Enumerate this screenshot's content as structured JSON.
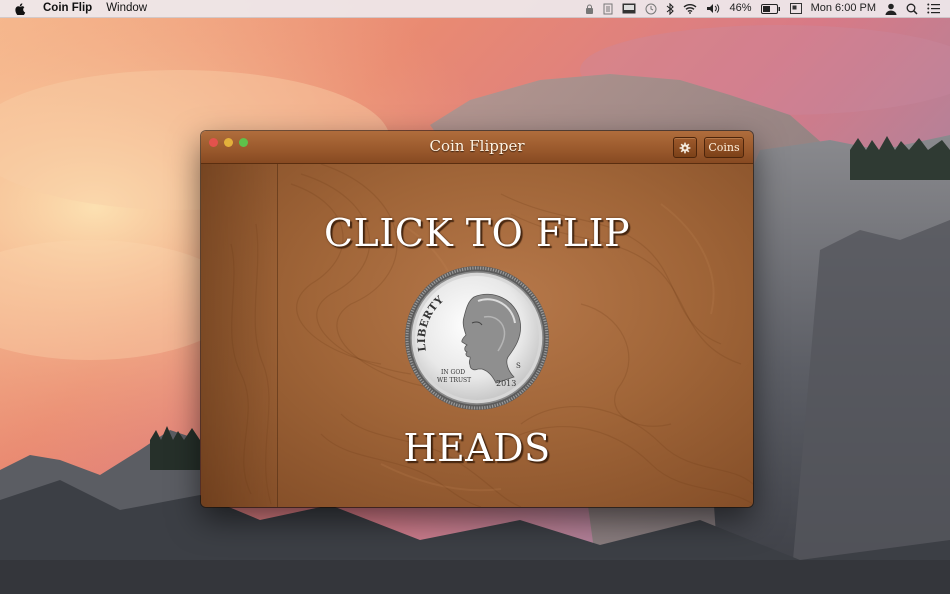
{
  "menubar": {
    "app_name": "Coin Flip",
    "menu_window": "Window",
    "battery_percent": "46%",
    "clock": "Mon 6:00 PM"
  },
  "window": {
    "title": "Coin Flipper",
    "coins_button": "Coins",
    "instruction": "CLICK TO FLIP",
    "result": "HEADS"
  },
  "coin": {
    "motto": "LIBERTY",
    "motto2_line1": "IN GOD",
    "motto2_line2": "WE TRUST",
    "year": "2013",
    "mint_mark": "S"
  },
  "colors": {
    "wood": "#a06538",
    "titlebar": "#9b5a2d",
    "text": "#ffffff"
  }
}
